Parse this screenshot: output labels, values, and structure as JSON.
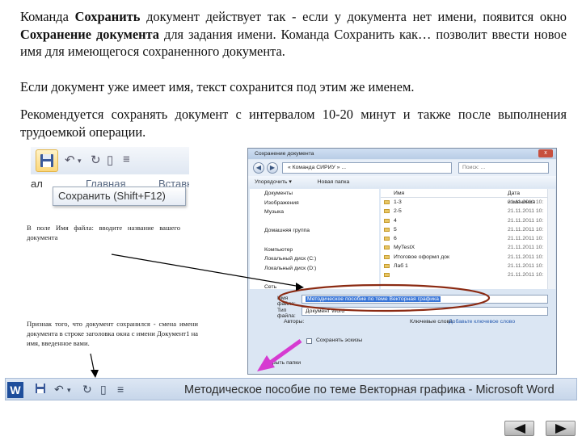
{
  "paragraphs": {
    "p1_a": "Команда ",
    "p1_b": "Сохранить",
    "p1_c": " документ действует так - если у документа нет имени, появится окно ",
    "p1_d": "Сохранение документа",
    "p1_e": " для задания имени. Команда Сохранить как… позволит ввести новое имя для имеющегося сохраненного документа.",
    "p2": "Если документ уже имеет имя, текст сохранится под этим же именем.",
    "p3": "Рекомендуется сохранять документ с интервалом 10-20 минут и также после выполнения трудоемкой операции."
  },
  "toolbar_crop": {
    "tab_home": "Главная",
    "tab_insert": "Вставка",
    "tooltip": "Сохранить (Shift+F12)",
    "side_text": "ал"
  },
  "notes": {
    "note1": "В поле Имя файла: вводите название вашего документа",
    "note2": "Признак того, что документ сохранился - смена имени документа в строке заголовка окна с имени Документ1 на имя, введенное вами."
  },
  "dialog": {
    "title": "Сохранение документа",
    "close": "x",
    "address": "« Команда СИРИУ » ...",
    "search_placeholder": "Поиск: ...",
    "commands": [
      "Упорядочить ▾",
      "Новая папка"
    ],
    "nav_items": [
      "Документы",
      "Изображения",
      "Музыка",
      "",
      "Домашняя группа",
      "",
      "Компьютер",
      "Локальный диск (C:)",
      "Локальный диск (D:)",
      "",
      "Сеть"
    ],
    "columns": {
      "name": "Имя",
      "date": "Дата изменения"
    },
    "files": [
      {
        "name": "1-3",
        "date": "21.11.2011 10:"
      },
      {
        "name": "2-5",
        "date": "21.11.2011 10:"
      },
      {
        "name": "4",
        "date": "21.11.2011 10:"
      },
      {
        "name": "5",
        "date": "21.11.2011 10:"
      },
      {
        "name": "6",
        "date": "21.11.2011 10:"
      },
      {
        "name": "MyTestX",
        "date": "21.11.2011 10:"
      },
      {
        "name": "Итоговое оформл док",
        "date": "21.11.2011 10:"
      },
      {
        "name": "Лаб 1",
        "date": "21.11.2011 10:"
      },
      {
        "name": "",
        "date": "21.11.2011 10:"
      }
    ],
    "file_name_label": "Имя файла:",
    "file_name_value": "Методическое пособие по теме Векторная графика",
    "file_type_label": "Тип файла:",
    "file_type_value": "Документ Word",
    "authors_label": "Авторы:",
    "tags_label": "Ключевые слова:",
    "tags_value": "Добавьте ключевое слово",
    "thumbnail_label": "Сохранять эскизы",
    "hide_folders": "Скрыть папки"
  },
  "wordbar": {
    "logo": "W",
    "title": "Методическое пособие по теме Векторная графика - Microsoft Word"
  },
  "colors": {
    "ellipse": "#8b2a12",
    "pink_arrow": "#d63bd1",
    "selection": "#3875d7",
    "word_blue": "#1e4e9c"
  }
}
